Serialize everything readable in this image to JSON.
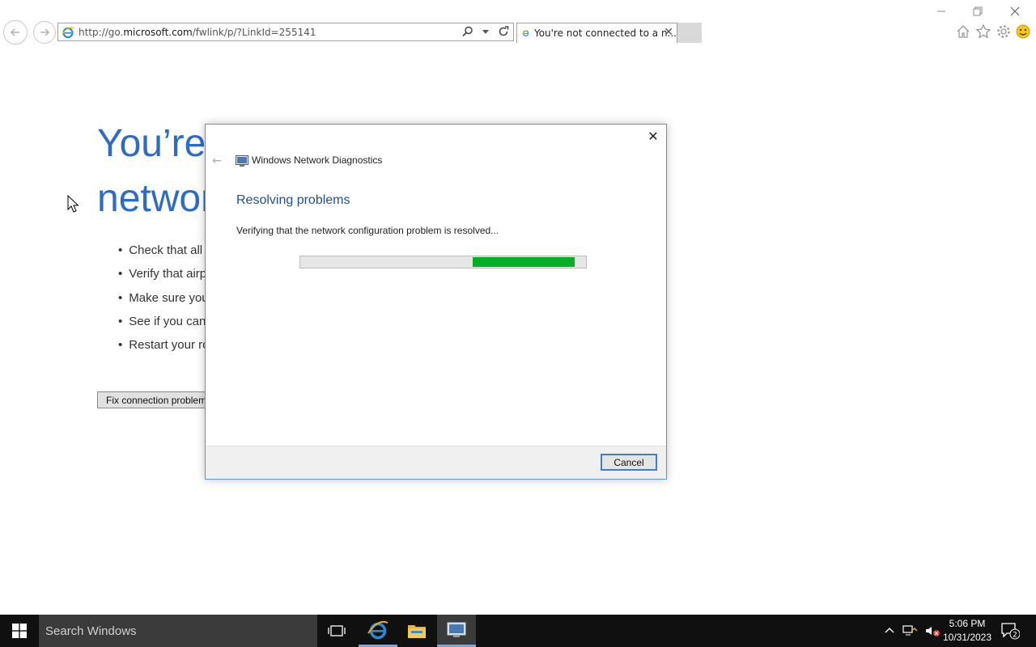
{
  "browser": {
    "address": {
      "prefix": "http://go.",
      "domain": "microsoft.com",
      "path": "/fwlink/p/?LinkId=255141"
    },
    "tab_title": "You're not connected to a n...",
    "tab_close": "✕"
  },
  "page": {
    "heading_line1": "You’re not connected to a",
    "heading_line2": "network",
    "tips": [
      "Check that all network cables are plugged in.",
      "Verify that airplane mode is turned off.",
      "Make sure your wireless switch is turned on.",
      "See if you can connect to mobile broadband.",
      "Restart your router."
    ],
    "fix_button": "Fix connection problems"
  },
  "dialog": {
    "title": "Windows Network Diagnostics",
    "heading": "Resolving problems",
    "status": "Verifying that the network configuration problem is resolved...",
    "progress_start": 0.604,
    "progress_end": 0.96,
    "cancel_label": "Cancel",
    "close_glyph": "✕",
    "back_glyph": "←"
  },
  "taskbar": {
    "search_placeholder": "Search Windows",
    "time": "5:06 PM",
    "date": "10/31/2023",
    "notifications": "2"
  },
  "colors": {
    "accent": "#2b6cc8",
    "progress": "#06b025",
    "taskbar": "#101010"
  }
}
